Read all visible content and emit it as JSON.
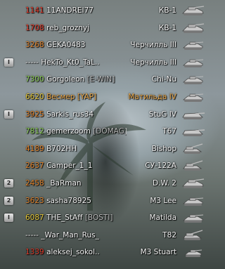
{
  "colors": {
    "rating_red": "#e03a2a",
    "rating_orange": "#e0832c",
    "rating_yellow": "#e6c93a",
    "rating_green": "#8fd15a",
    "self_orange": "#e9a84a"
  },
  "roster": [
    {
      "rank": "",
      "rating": "1141",
      "rating_color": "#e03a2a",
      "name": "11ANDREI77",
      "clan": "",
      "tank": "КВ-1",
      "icon": "heavy-tank-icon",
      "self": false
    },
    {
      "rank": "",
      "rating": "1708",
      "rating_color": "#e03a2a",
      "name": "reb_groznyj",
      "clan": "",
      "tank": "КВ-1",
      "icon": "heavy-tank-icon",
      "self": false
    },
    {
      "rank": "",
      "rating": "3268",
      "rating_color": "#e0832c",
      "name": "GEKA0483",
      "clan": "",
      "tank": "Черчилль III",
      "icon": "medium-tank-icon",
      "self": false
    },
    {
      "rank": "I",
      "rating": "-----",
      "rating_color": "#f2f2f2",
      "name": "HekTo_Kt0_TaL..",
      "clan": "",
      "tank": "Черчилль III",
      "icon": "medium-tank-icon",
      "self": false
    },
    {
      "rank": "",
      "rating": "7300",
      "rating_color": "#8fd15a",
      "name": "Gorgoleon",
      "clan": "[E-WIN]",
      "tank": "Chi-Nu",
      "icon": "medium-tank-icon",
      "self": false
    },
    {
      "rank": "",
      "rating": "6620",
      "rating_color": "#e6c93a",
      "name": "Весмер",
      "clan": "[YAP]",
      "tank": "Матильда IV",
      "icon": "medium-tank-icon",
      "self": true
    },
    {
      "rank": "I",
      "rating": "3925",
      "rating_color": "#e0832c",
      "name": "Sarkis_rus34",
      "clan": "",
      "tank": "StuG IV",
      "icon": "tank-destroyer-icon",
      "self": false
    },
    {
      "rank": "",
      "rating": "7812",
      "rating_color": "#8fd15a",
      "name": "gemerzoom",
      "clan": "[DOMAG]",
      "tank": "T67",
      "icon": "tank-destroyer-icon",
      "self": false
    },
    {
      "rank": "",
      "rating": "4189",
      "rating_color": "#e0832c",
      "name": "B702HH",
      "clan": "",
      "tank": "Bishop",
      "icon": "spg-icon",
      "self": false
    },
    {
      "rank": "",
      "rating": "2637",
      "rating_color": "#e0832c",
      "name": "Camper_1_1",
      "clan": "",
      "tank": "СУ-122А",
      "icon": "spg-icon",
      "self": false
    },
    {
      "rank": "2",
      "rating": "2458",
      "rating_color": "#e0832c",
      "name": "_BaRman",
      "clan": "",
      "tank": "D.W. 2",
      "icon": "heavy-tank-icon",
      "self": false
    },
    {
      "rank": "2",
      "rating": "3623",
      "rating_color": "#e0832c",
      "name": "sasha78925",
      "clan": "",
      "tank": "M3 Lee",
      "icon": "medium-tank-icon",
      "self": false
    },
    {
      "rank": "I",
      "rating": "6087",
      "rating_color": "#e6c93a",
      "name": "THE_StAff",
      "clan": "[BOSTI]",
      "tank": "Matilda",
      "icon": "medium-tank-icon",
      "self": false
    },
    {
      "rank": "",
      "rating": "-----",
      "rating_color": "#f2f2f2",
      "name": "_War_Man_Rus_",
      "clan": "",
      "tank": "T82",
      "icon": "spg-icon",
      "self": false
    },
    {
      "rank": "",
      "rating": "1339",
      "rating_color": "#e03a2a",
      "name": "aleksej_sokol..",
      "clan": "",
      "tank": "M3 Stuart",
      "icon": "light-tank-icon",
      "self": false
    }
  ]
}
